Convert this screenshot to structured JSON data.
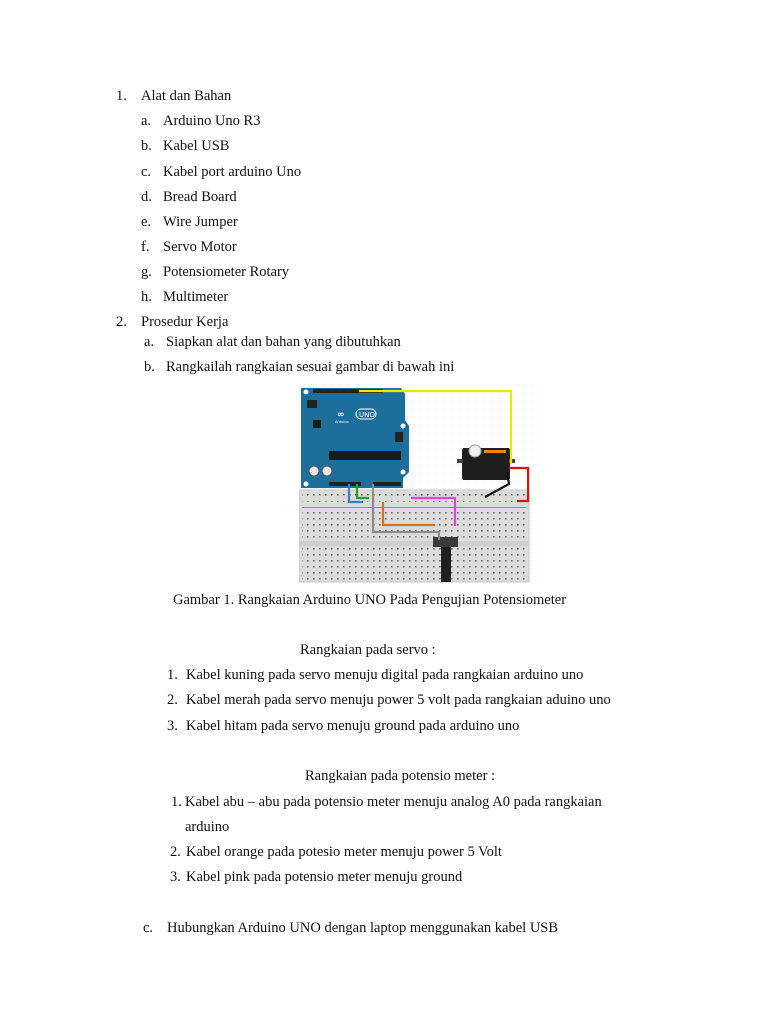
{
  "section1": {
    "number": "1.",
    "title": "Alat  dan Bahan",
    "items": [
      {
        "marker": "a.",
        "text": "Arduino Uno R3"
      },
      {
        "marker": "b.",
        "text": "Kabel USB"
      },
      {
        "marker": "c.",
        "text": "Kabel port arduino Uno"
      },
      {
        "marker": "d.",
        "text": "Bread Board"
      },
      {
        "marker": "e.",
        "text": "Wire Jumper"
      },
      {
        "marker": "f.",
        "text": "Servo Motor"
      },
      {
        "marker": "g.",
        "text": "Potensiometer Rotary"
      },
      {
        "marker": "h.",
        "text": "Multimeter"
      }
    ]
  },
  "section2": {
    "number": "2.",
    "title": "Prosedur Kerja",
    "items": [
      {
        "marker": "a.",
        "text": "Siapkan alat dan bahan yang dibutuhkan"
      },
      {
        "marker": "b.",
        "text": "Rangkailah rangkaian sesuai gambar di bawah ini"
      }
    ],
    "figure": {
      "caption": "Gambar 1. Rangkaian Arduino UNO Pada Pengujian Potensiometer",
      "board_logo": "UNO",
      "board_brand": "Arduino",
      "wire_colors": {
        "yellow": "#f2e600",
        "red": "#e01010",
        "black": "#111111",
        "blue": "#3a78d6",
        "green": "#1aa51a",
        "gray": "#8c8c8c",
        "orange": "#d2741c",
        "pink": "#d64ad6"
      },
      "board_color": "#1d6f9b"
    },
    "servo_heading": "Rangkaian pada servo :",
    "servo_items": [
      {
        "marker": "1.",
        "text": "Kabel kuning pada servo menuju digital pada rangkaian arduino uno"
      },
      {
        "marker": "2.",
        "text": "Kabel merah pada servo menuju power 5 volt pada rangkaian aduino uno"
      },
      {
        "marker": "3.",
        "text": "Kabel hitam pada servo menuju ground pada arduino uno"
      }
    ],
    "pot_heading": "Rangkaian pada potensio meter :",
    "pot_items": [
      {
        "marker": "1.",
        "text": "Kabel abu – abu pada potensio meter menuju analog A0 pada rangkaian",
        "continuation": "arduino"
      },
      {
        "marker": "2.",
        "text": "Kabel orange pada potesio meter menuju power 5 Volt"
      },
      {
        "marker": "3.",
        "text": "Kabel pink pada potensio meter menuju ground"
      }
    ],
    "step_c": {
      "marker": "c.",
      "text": "Hubungkan Arduino UNO dengan laptop menggunakan kabel USB"
    }
  }
}
